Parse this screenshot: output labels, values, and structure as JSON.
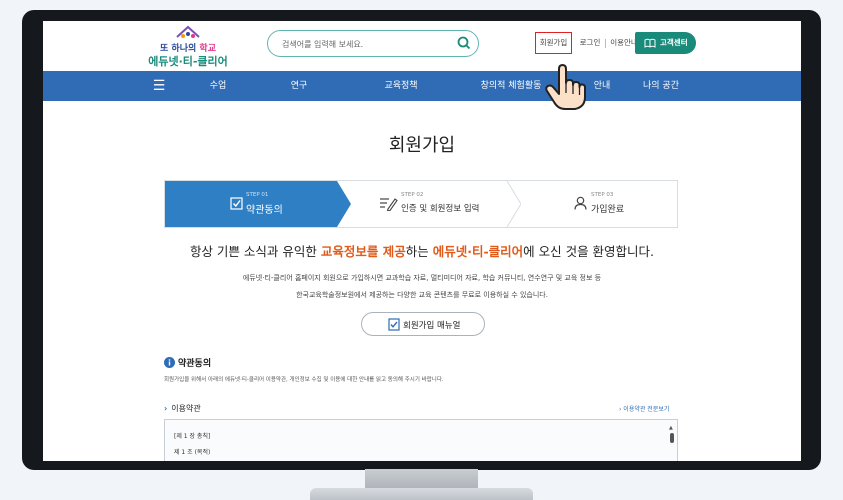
{
  "header": {
    "logo_line1_prefix": "또 하나의",
    "logo_line1_accent": "학교",
    "logo_line2": "에듀넷·티-클리어",
    "search_placeholder": "검색어를 입력해 보세요.",
    "links": {
      "signup": "회원가입",
      "login": "로그인",
      "guide": "이용안내"
    },
    "cs_button": "고객센터"
  },
  "nav": {
    "menu_icon": "☰",
    "items": [
      "수업",
      "연구",
      "교육정책",
      "창의적 체험활동",
      "안내",
      "나의 공간"
    ]
  },
  "page": {
    "title": "회원가입",
    "steps": [
      {
        "num": "STEP 01",
        "label": "약관동의",
        "icon": "check-icon"
      },
      {
        "num": "STEP 02",
        "label": "인증 및 회원정보 입력",
        "icon": "form-edit-icon"
      },
      {
        "num": "STEP 03",
        "label": "가입완료",
        "icon": "person-icon"
      }
    ],
    "welcome": {
      "part1": "항상 기쁜 소식과 유익한 ",
      "hl1": "교육정보를 제공",
      "part2": "하는 ",
      "hl2": "에듀넷·티-클리어",
      "part3": "에 오신 것을 환영합니다."
    },
    "desc_line1": "에듀넷·티-클리어 홈페이지 회원으로 가입하시면 교과학습 자료, 멀티미디어 자료, 학습 커뮤니티, 연수연구 및 교육 정보 등",
    "desc_line2": "한국교육학술정보원에서 제공하는 다양한 교육 콘텐츠를 무료로 이용하실 수 있습니다.",
    "manual_button": "회원가입 매뉴얼",
    "section_title": "약관동의",
    "section_desc": "회원가입을 위해서 아래의 에듀넷·티-클리어 이용약관, 개인정보 수집 및 이용에 대한 안내를 읽고 동의해 주시기 바랍니다.",
    "terms_heading": "이용약관",
    "terms_link": "› 이용약관 전문보기",
    "terms_lines": [
      "[제 1 장 총칙]",
      "제 1 조 (목적)"
    ]
  },
  "colors": {
    "nav": "#2f6cb5",
    "accent": "#1a8b7a",
    "highlight": "#e05a1a",
    "signup_border": "#e02222"
  }
}
